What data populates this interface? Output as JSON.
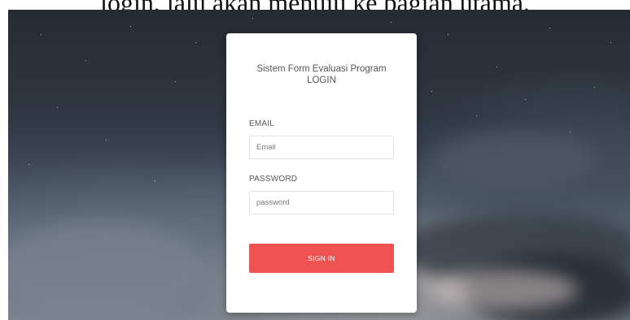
{
  "caption_fragment": "login, lalu akan menuju ke bagian utama.",
  "login_form": {
    "title_line1": "Sistem Form Evaluasi Program",
    "title_line2": "LOGIN",
    "email_label": "EMAIL",
    "email_placeholder": "Email",
    "email_value": "",
    "password_label": "PASSWORD",
    "password_placeholder": "password",
    "password_value": "",
    "signin_label": "SIGN IN"
  },
  "colors": {
    "signin_button": "#ee5352",
    "card_background": "#ffffff",
    "label_text": "#555555"
  }
}
